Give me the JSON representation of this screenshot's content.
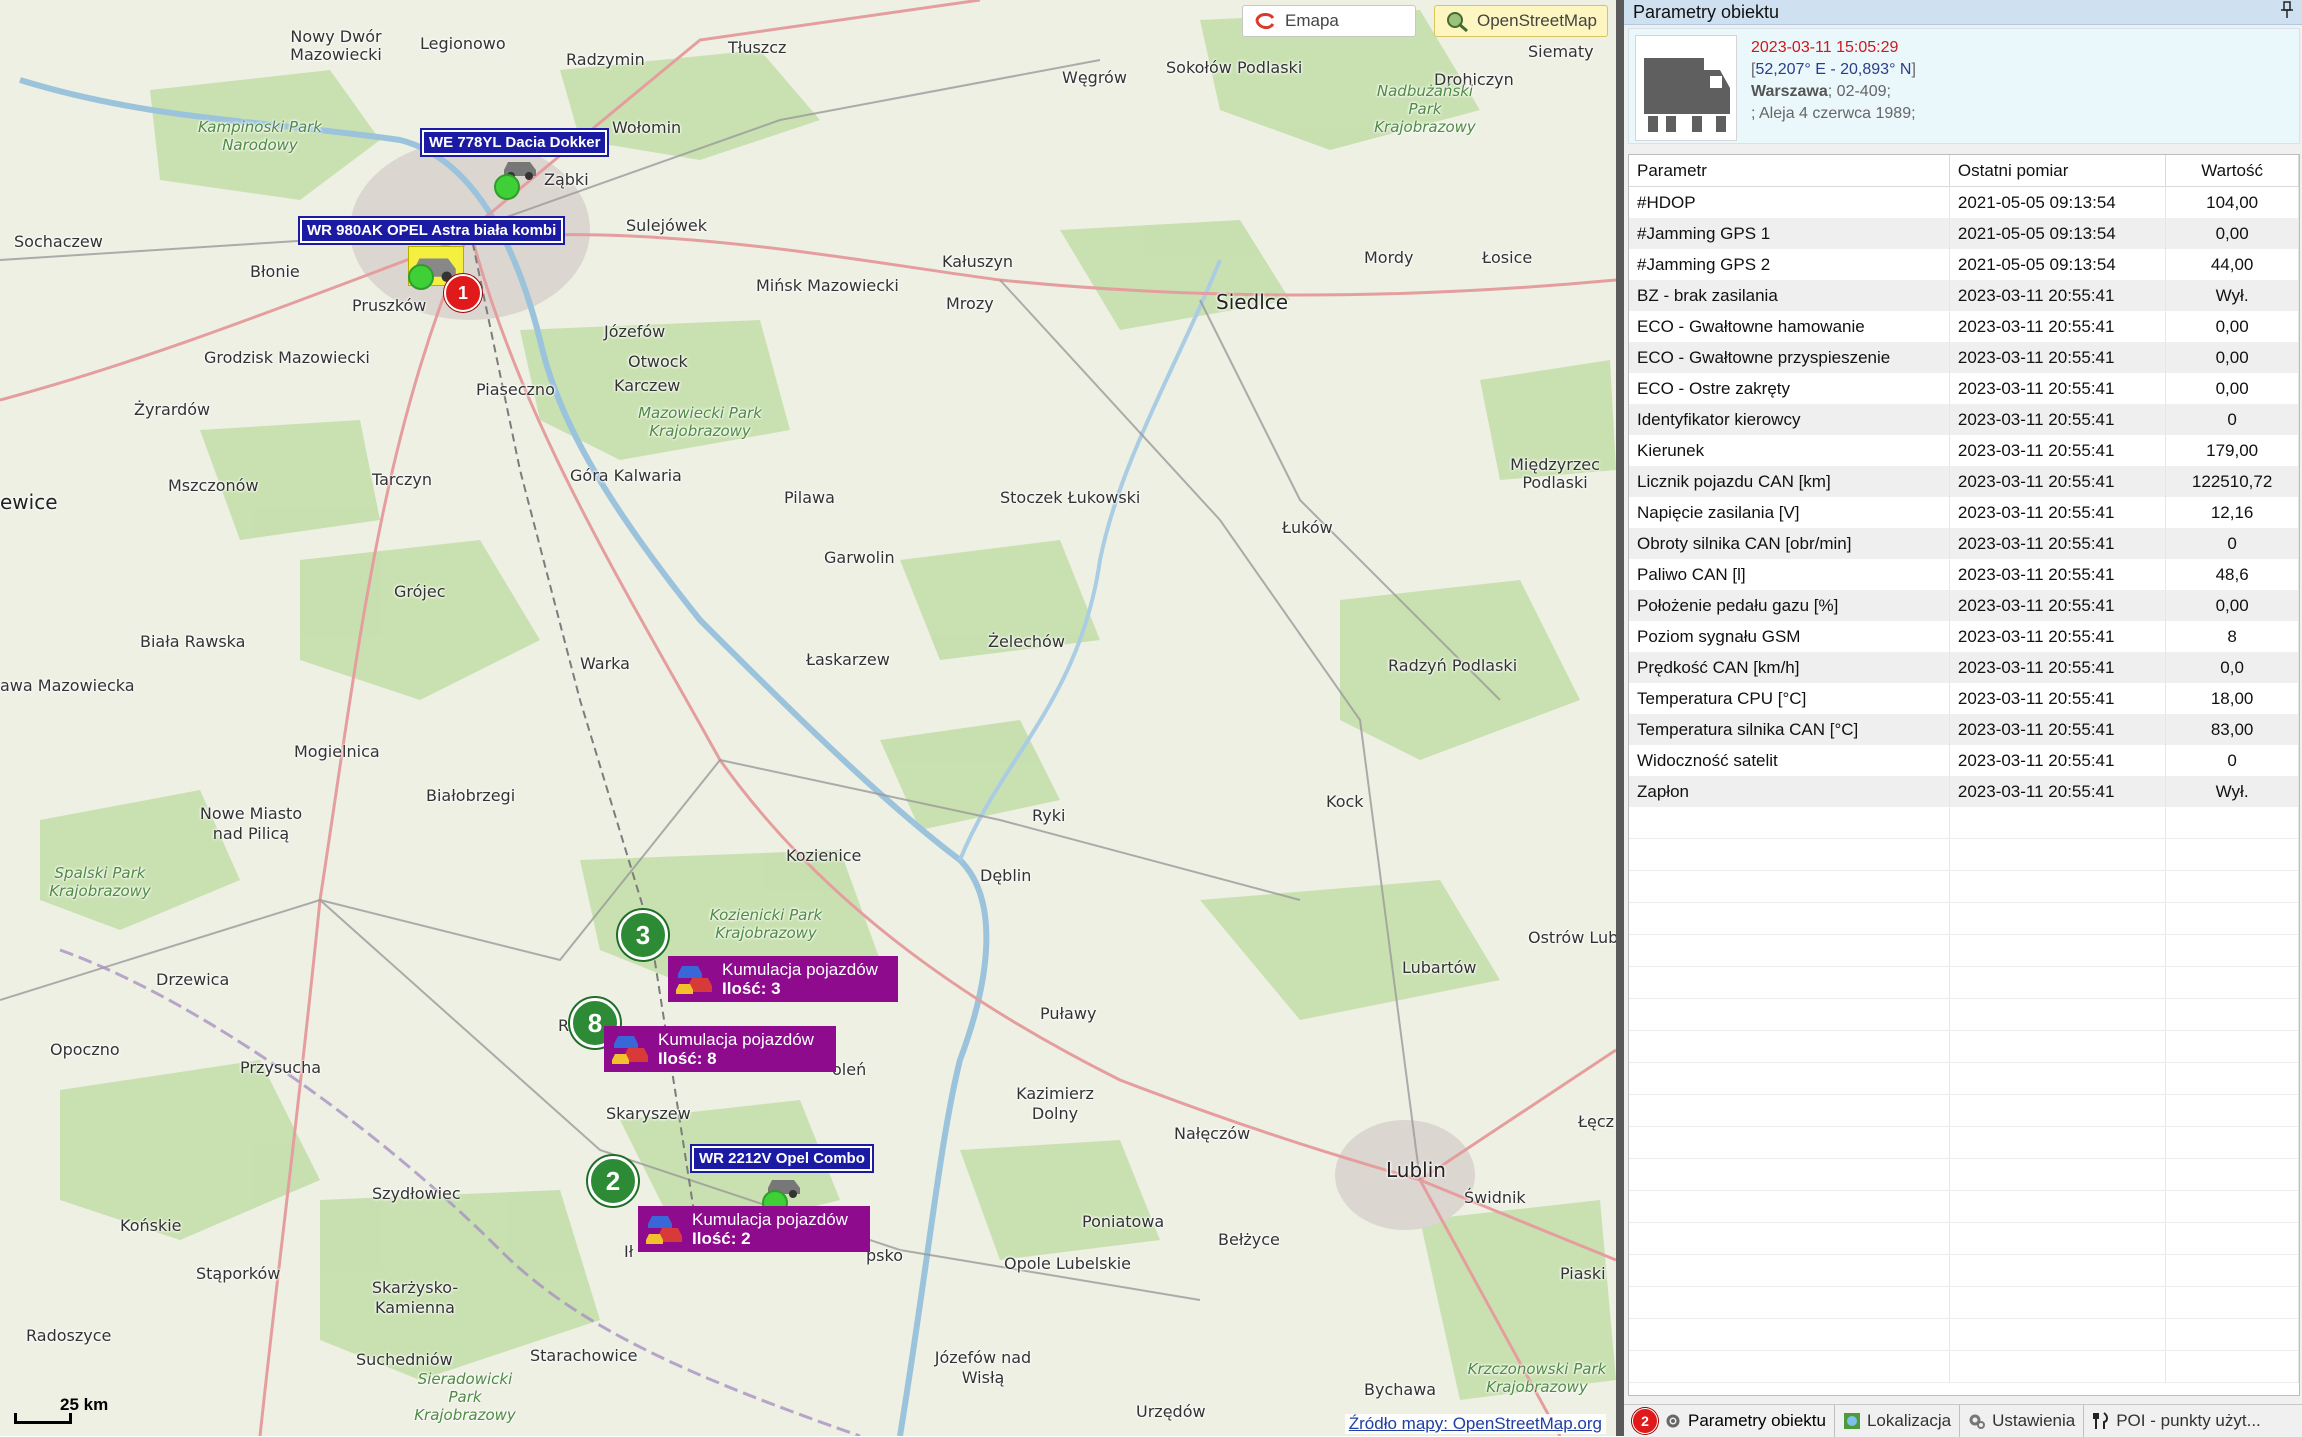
{
  "map": {
    "buttons": {
      "emapa": "Emapa",
      "osm": "OpenStreetMap"
    },
    "scale": "25 km",
    "source": "Źródło mapy: OpenStreetMap.org",
    "places": {
      "nowydwor": "Nowy Dwór Mazowiecki",
      "legionowo": "Legionowo",
      "radzymin": "Radzymin",
      "tluszcz": "Tłuszcz",
      "wegrow": "Węgrów",
      "sokolow": "Sokołów Podlaski",
      "drohiczyn": "Drohiczyn",
      "siematy": "Siematy",
      "wolomin": "Wołomin",
      "zabki": "Ząbki",
      "sulejowek": "Sulejówek",
      "sochaczew": "Sochaczew",
      "blonie": "Błonie",
      "pruszkow": "Pruszków",
      "kaluszyn": "Kałuszyn",
      "minsk": "Mińsk Mazowiecki",
      "mrozy": "Mrozy",
      "mordy": "Mordy",
      "losice": "Łosice",
      "siedlce": "Siedlce",
      "grodzisk": "Grodzisk Mazowiecki",
      "jozefow": "Józefów",
      "otwock": "Otwock",
      "karczew": "Karczew",
      "piaseczno": "Piaseczno",
      "zyrardow": "Żyrardów",
      "mszczonow": "Mszczonów",
      "tarczyn": "Tarczyn",
      "gorakalwaria": "Góra Kalwaria",
      "pilawa": "Pilawa",
      "stoczek": "Stoczek Łukowski",
      "lukow": "Łuków",
      "miedzyrzec": "Międzyrzec Podlaski",
      "ewice": "ewice",
      "grojec": "Grójec",
      "garwolin": "Garwolin",
      "bialarawska": "Biała Rawska",
      "laskarzew": "Łaskarzew",
      "zelechow": "Żelechów",
      "warka": "Warka",
      "radzyn": "Radzyń Podlaski",
      "rawa": "awa Mazowiecka",
      "mogielnica": "Mogielnica",
      "bialobrzegi": "Białobrzegi",
      "kock": "Kock",
      "nowemiasto": "Nowe Miasto nad Pilicą",
      "ryki": "Ryki",
      "kozienice": "Kozienice",
      "deblin": "Dęblin",
      "ostrow": "Ostrów Lub",
      "drzewica": "Drzewica",
      "lubartow": "Lubartów",
      "pulawy": "Puławy",
      "opoczno": "Opoczno",
      "przysucha": "Przysucha",
      "r": "R",
      "olen": "oleń",
      "kazimierz": "Kazimierz Dolny",
      "skaryszew": "Skaryszew",
      "naleczow": "Nałęczów",
      "leczna": "Łęcz",
      "szydlowiec": "Szydłowiec",
      "lublin": "Lublin",
      "swidnik": "Świdnik",
      "poniatowa": "Poniatowa",
      "konskie": "Końskie",
      "ilz": "Ił",
      "lipsko": "psko",
      "belzyce": "Bełżyce",
      "opole": "Opole Lubelskie",
      "staporkow": "Stąporków",
      "skarzysko": "Skarżysko-Kamienna",
      "piaski": "Piaski",
      "radoszyce": "Radoszyce",
      "suchedniow": "Suchedniów",
      "starachowice": "Starachowice",
      "jozefownad": "Józefów nad Wisłą",
      "urzedow": "Urzędów",
      "bychawa": "Bychawa"
    },
    "parks": {
      "kampinoski": "Kampinoski Park Narodowy",
      "nadbuzanski": "Nadbużański Park Krajobrazowy",
      "mazowiecki": "Mazowiecki Park Krajobrazowy",
      "kozienicki": "Kozienicki Park Krajobrazowy",
      "spalski": "Spalski Park Krajobrazowy",
      "sieradowicki": "Sieradowicki Park Krajobrazowy",
      "krzczonowski": "Krzczonowski Park Krajobrazowy"
    },
    "vehicles": [
      {
        "label": "WE 778YL Dacia Dokker"
      },
      {
        "label": "WR 980AK OPEL Astra biała kombi"
      },
      {
        "label": "WR 2212V Opel Combo"
      }
    ],
    "selected_badge": "1",
    "clusters": [
      {
        "badge": "3",
        "title": "Kumulacja pojazdów",
        "count": "Ilość: 3"
      },
      {
        "badge": "8",
        "title": "Kumulacja pojazdów",
        "count": "Ilość: 8"
      },
      {
        "badge": "2",
        "title": "Kumulacja pojazdów",
        "count": "Ilość: 2"
      }
    ]
  },
  "panel": {
    "title": "Parametry obiektu",
    "pin_icon": "pin-icon",
    "object": {
      "time": "2023-03-11  15:05:29",
      "coords": "52,207° E - 20,893° N",
      "city": "Warszawa",
      "zip": "; 02-409;",
      "street": "; Aleja 4 czerwca 1989;"
    },
    "table": {
      "headers": [
        "Parametr",
        "Ostatni pomiar",
        "Wartość"
      ],
      "rows": [
        [
          "#HDOP",
          "2021-05-05 09:13:54",
          "104,00"
        ],
        [
          "#Jamming GPS 1",
          "2021-05-05 09:13:54",
          "0,00"
        ],
        [
          "#Jamming GPS 2",
          "2021-05-05 09:13:54",
          "44,00"
        ],
        [
          "BZ - brak zasilania",
          "2023-03-11 20:55:41",
          "Wył."
        ],
        [
          "ECO - Gwałtowne hamowanie",
          "2023-03-11 20:55:41",
          "0,00"
        ],
        [
          "ECO - Gwałtowne przyspieszenie",
          "2023-03-11 20:55:41",
          "0,00"
        ],
        [
          "ECO - Ostre zakręty",
          "2023-03-11 20:55:41",
          "0,00"
        ],
        [
          "Identyfikator kierowcy",
          "2023-03-11 20:55:41",
          "0"
        ],
        [
          "Kierunek",
          "2023-03-11 20:55:41",
          "179,00"
        ],
        [
          "Licznik pojazdu CAN [km]",
          "2023-03-11 20:55:41",
          "122510,72"
        ],
        [
          "Napięcie zasilania [V]",
          "2023-03-11 20:55:41",
          "12,16"
        ],
        [
          "Obroty silnika CAN [obr/min]",
          "2023-03-11 20:55:41",
          "0"
        ],
        [
          "Paliwo CAN [l]",
          "2023-03-11 20:55:41",
          "48,6"
        ],
        [
          "Położenie pedału gazu [%]",
          "2023-03-11 20:55:41",
          "0,00"
        ],
        [
          "Poziom sygnału GSM",
          "2023-03-11 20:55:41",
          "8"
        ],
        [
          "Prędkość CAN [km/h]",
          "2023-03-11 20:55:41",
          "0,0"
        ],
        [
          "Temperatura CPU [°C]",
          "2023-03-11 20:55:41",
          "18,00"
        ],
        [
          "Temperatura silnika CAN [°C]",
          "2023-03-11 20:55:41",
          "83,00"
        ],
        [
          "Widoczność satelit",
          "2023-03-11 20:55:41",
          "0"
        ],
        [
          "Zapłon",
          "2023-03-11 20:55:41",
          "Wył."
        ]
      ]
    },
    "tabs": [
      {
        "label": "Parametry obiektu",
        "badge": "2",
        "icon": "gear-icon"
      },
      {
        "label": "Lokalizacja",
        "icon": "globe-icon"
      },
      {
        "label": "Ustawienia",
        "icon": "gear-icon"
      },
      {
        "label": "POI - punkty użyt...",
        "icon": "fork-knife-icon"
      }
    ]
  }
}
